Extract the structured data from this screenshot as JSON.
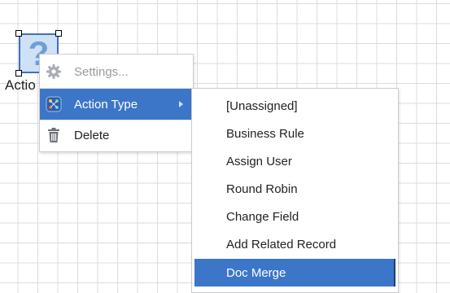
{
  "canvas": {
    "node": {
      "label": "Actio",
      "glyph": "?"
    }
  },
  "context_menu": {
    "items": [
      {
        "label": "Settings...",
        "icon": "gear-icon",
        "state": "disabled"
      },
      {
        "label": "Action Type",
        "icon": "action-type-icon",
        "state": "highlighted",
        "has_submenu": true
      },
      {
        "label": "Delete",
        "icon": "trash-icon",
        "state": "normal"
      }
    ]
  },
  "submenu": {
    "items": [
      {
        "label": "[Unassigned]"
      },
      {
        "label": "Business Rule"
      },
      {
        "label": "Assign User"
      },
      {
        "label": "Round Robin"
      },
      {
        "label": "Change Field"
      },
      {
        "label": "Add Related Record"
      },
      {
        "label": "Doc Merge",
        "selected": true
      }
    ]
  },
  "colors": {
    "highlight": "#3c76c8",
    "node_border": "#3d6fc6",
    "node_fill": "#cfe1f5",
    "grid": "#dcdcdc",
    "disabled_text": "#9a9a9a"
  }
}
